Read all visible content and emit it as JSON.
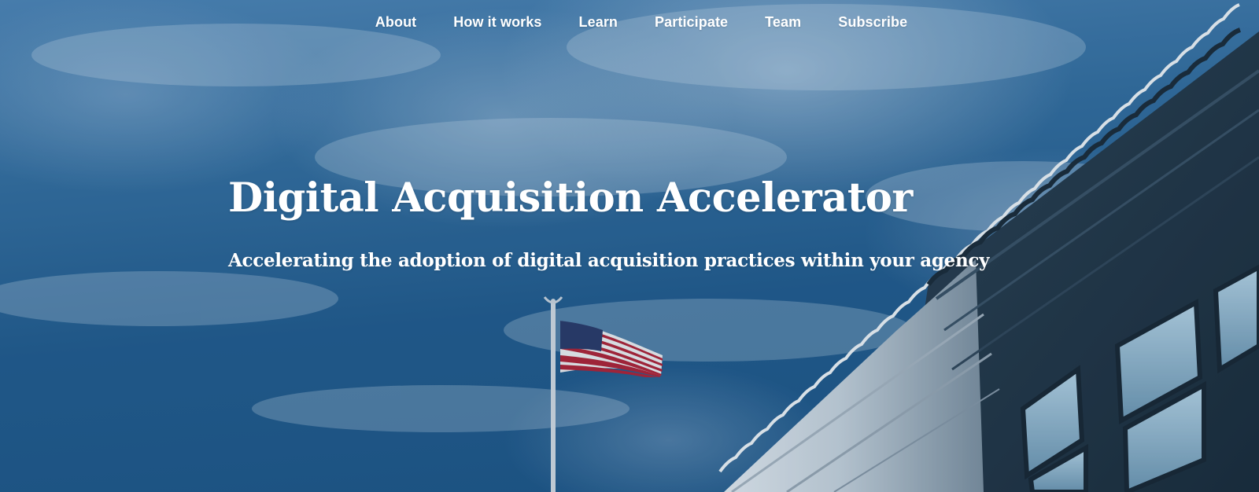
{
  "nav": {
    "items": [
      {
        "label": "About"
      },
      {
        "label": "How it works"
      },
      {
        "label": "Learn"
      },
      {
        "label": "Participate"
      },
      {
        "label": "Team"
      },
      {
        "label": "Subscribe"
      }
    ]
  },
  "hero": {
    "title": "Digital Acquisition Accelerator",
    "subtitle": "Accelerating the adoption of digital acquisition practices within your agency",
    "background_image": "sky-flag-building-photo"
  },
  "colors": {
    "text": "#ffffff",
    "sky_dark": "#1d5585",
    "sky_light": "#4f86b6"
  }
}
